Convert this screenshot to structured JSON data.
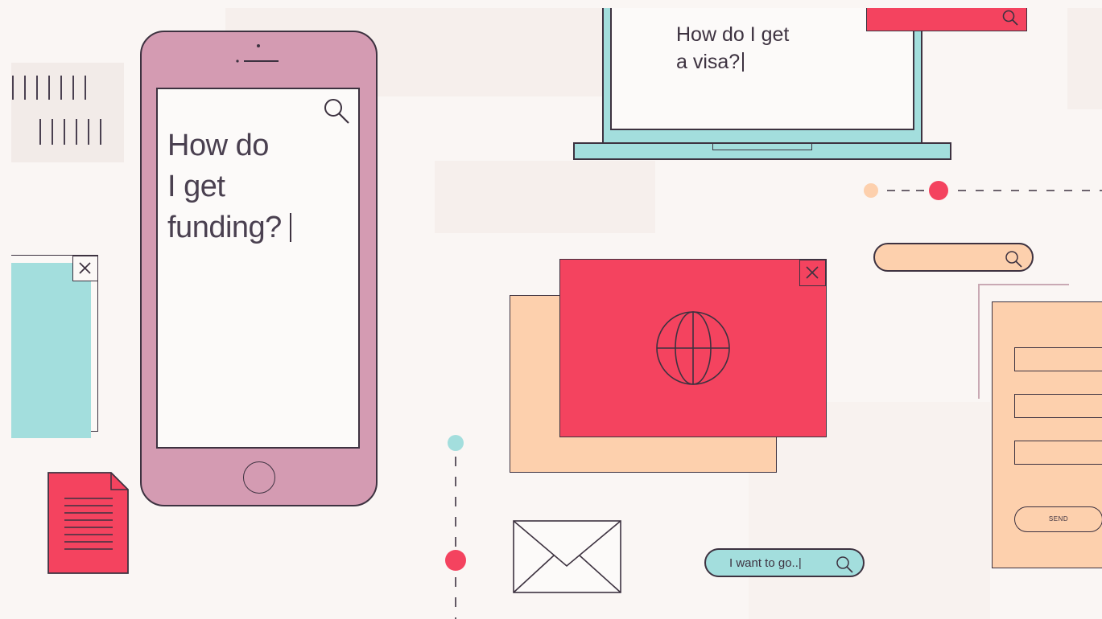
{
  "phone": {
    "query_lines": [
      "How do",
      "I get",
      "funding?"
    ],
    "icons": {
      "search": "search-icon",
      "home": "home-button-icon"
    }
  },
  "laptop": {
    "query_lines": [
      "How do I get",
      "a visa?"
    ],
    "icons": {
      "search": "search-icon"
    }
  },
  "go_search": {
    "text": "I want to go..|"
  },
  "form": {
    "send_label": "SEND"
  },
  "colors": {
    "background": "#faf6f4",
    "phone": "#d49bb2",
    "teal": "#a3dedd",
    "red": "#f4435f",
    "peach": "#fdd0ad",
    "outline": "#3d3240"
  }
}
